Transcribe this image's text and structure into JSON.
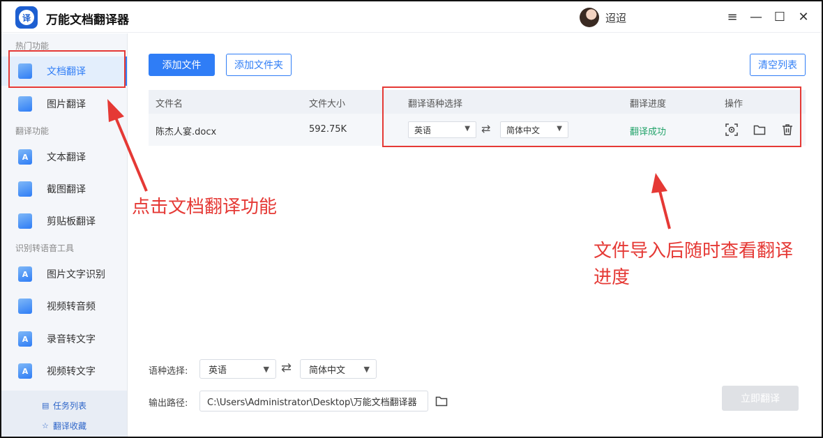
{
  "app": {
    "title": "万能文档翻译器",
    "logo_char": "译",
    "user_name": "迢迢"
  },
  "window_controls": {
    "menu": "≡",
    "minimize": "—",
    "maximize": "☐",
    "close": "✕"
  },
  "sidebar": {
    "sections": [
      {
        "title": "热门功能"
      },
      {
        "title": "翻译功能"
      },
      {
        "title": "识别转语音工具"
      }
    ],
    "items": [
      {
        "label": "文档翻译",
        "icon": "document-icon",
        "active": true
      },
      {
        "label": "图片翻译",
        "icon": "image-icon"
      },
      {
        "label": "文本翻译",
        "icon": "text-icon",
        "glyph": "A"
      },
      {
        "label": "截图翻译",
        "icon": "screenshot-icon"
      },
      {
        "label": "剪贴板翻译",
        "icon": "clipboard-icon"
      },
      {
        "label": "图片文字识别",
        "icon": "ocr-icon",
        "glyph": "A"
      },
      {
        "label": "视频转音频",
        "icon": "video-audio-icon"
      },
      {
        "label": "录音转文字",
        "icon": "recording-icon",
        "glyph": "A"
      },
      {
        "label": "视频转文字",
        "icon": "video-text-icon",
        "glyph": "A"
      }
    ],
    "bottom": [
      {
        "label": "任务列表",
        "icon": "list-icon"
      },
      {
        "label": "翻译收藏",
        "icon": "star-icon"
      }
    ]
  },
  "toolbar": {
    "add_file": "添加文件",
    "add_folder": "添加文件夹",
    "clear_list": "清空列表"
  },
  "table": {
    "headers": [
      "文件名",
      "文件大小",
      "翻译语种选择",
      "翻译进度",
      "操作"
    ],
    "rows": [
      {
        "name": "陈杰人宴.docx",
        "size": "592.75K",
        "source_lang": "英语",
        "target_lang": "简体中文",
        "status": "翻译成功"
      }
    ]
  },
  "bottom_bar": {
    "lang_label": "语种选择:",
    "source_lang": "英语",
    "target_lang": "简体中文",
    "path_label": "输出路径:",
    "path_value": "C:\\Users\\Administrator\\Desktop\\万能文档翻译器",
    "translate_button": "立即翻译"
  },
  "annotations": {
    "note1": "点击文档翻译功能",
    "note2_line1": "文件导入后随时查看翻译",
    "note2_line2": "进度"
  },
  "colors": {
    "accent": "#2f7df6",
    "success": "#23a36a",
    "annotation": "#e53935"
  }
}
